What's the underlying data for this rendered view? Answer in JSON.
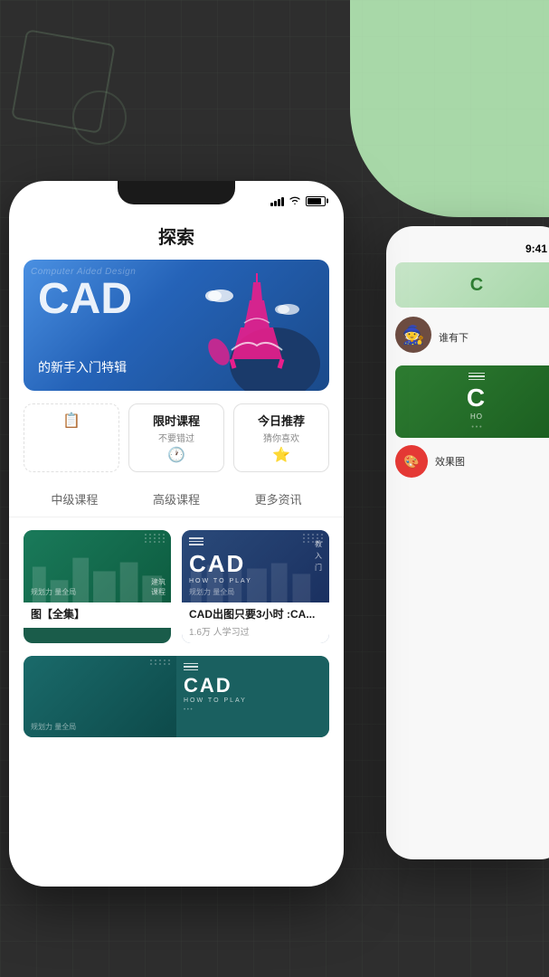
{
  "app": {
    "title": "探索"
  },
  "status_bar": {
    "time": "9:41",
    "signal_label": "signal",
    "wifi_label": "wifi",
    "battery_label": "battery"
  },
  "hero": {
    "bg_text": "Computer Aided Design",
    "big_text": "CAD",
    "subtitle": "的新手入门特辑"
  },
  "category_tabs": [
    {
      "title": "限时课程",
      "sub": "不要错过",
      "icon": "🕐"
    },
    {
      "title": "今日推荐",
      "sub": "猜你喜欢",
      "icon": "⭐"
    }
  ],
  "nav_links": [
    {
      "label": "中级课程"
    },
    {
      "label": "高级课程"
    },
    {
      "label": "更多资讯"
    }
  ],
  "courses": [
    {
      "title": "图【全集】",
      "meta": "",
      "thumb_type": "green"
    },
    {
      "title": "CAD出图只要3小时 :CA...",
      "meta": "1.6万 人学习过",
      "thumb_type": "blue"
    },
    {
      "title": "",
      "meta": "",
      "thumb_type": "teal"
    }
  ],
  "right_phone": {
    "time": "9:41",
    "text_who": "谁有下",
    "text_effect": "效果图",
    "cad_label": "C",
    "how_label": "HO"
  },
  "cad_thumb": {
    "menu_label": "≡",
    "big": "CAD",
    "sub": "HOW TO PLAY",
    "entry": "教\n入\n门"
  }
}
